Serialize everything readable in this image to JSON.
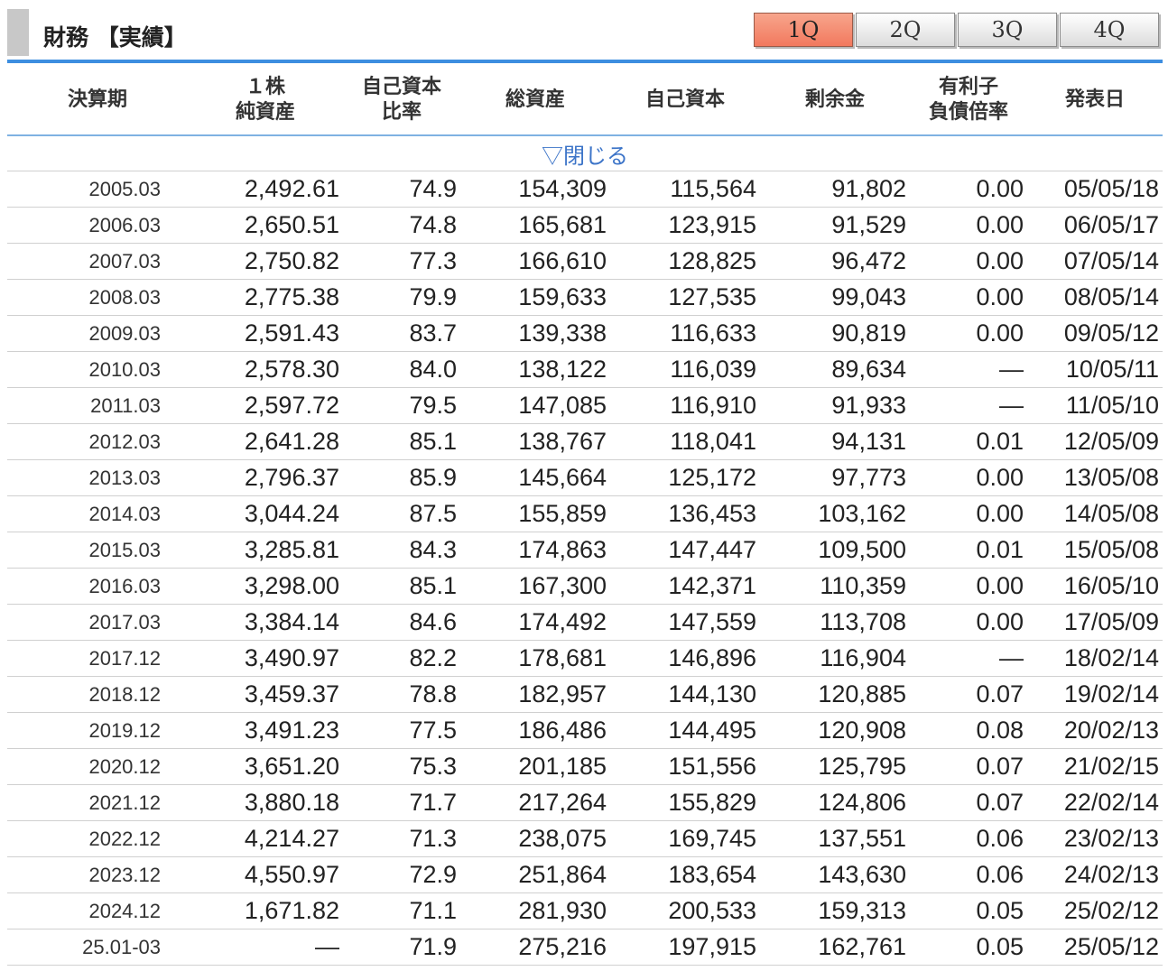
{
  "header": {
    "title": "財務 【実績】",
    "tabs": [
      "1Q",
      "2Q",
      "3Q",
      "4Q"
    ],
    "active_tab": "1Q"
  },
  "table": {
    "columns": [
      "決算期",
      "１株\n純資産",
      "自己資本\n比率",
      "総資産",
      "自己資本",
      "剰余金",
      "有利子\n負債倍率",
      "発表日"
    ],
    "toggle_label": "▽閉じる",
    "rows": [
      [
        "2005.03",
        "2,492.61",
        "74.9",
        "154,309",
        "115,564",
        "91,802",
        "0.00",
        "05/05/18"
      ],
      [
        "2006.03",
        "2,650.51",
        "74.8",
        "165,681",
        "123,915",
        "91,529",
        "0.00",
        "06/05/17"
      ],
      [
        "2007.03",
        "2,750.82",
        "77.3",
        "166,610",
        "128,825",
        "96,472",
        "0.00",
        "07/05/14"
      ],
      [
        "2008.03",
        "2,775.38",
        "79.9",
        "159,633",
        "127,535",
        "99,043",
        "0.00",
        "08/05/14"
      ],
      [
        "2009.03",
        "2,591.43",
        "83.7",
        "139,338",
        "116,633",
        "90,819",
        "0.00",
        "09/05/12"
      ],
      [
        "2010.03",
        "2,578.30",
        "84.0",
        "138,122",
        "116,039",
        "89,634",
        "—",
        "10/05/11"
      ],
      [
        "2011.03",
        "2,597.72",
        "79.5",
        "147,085",
        "116,910",
        "91,933",
        "—",
        "11/05/10"
      ],
      [
        "2012.03",
        "2,641.28",
        "85.1",
        "138,767",
        "118,041",
        "94,131",
        "0.01",
        "12/05/09"
      ],
      [
        "2013.03",
        "2,796.37",
        "85.9",
        "145,664",
        "125,172",
        "97,773",
        "0.00",
        "13/05/08"
      ],
      [
        "2014.03",
        "3,044.24",
        "87.5",
        "155,859",
        "136,453",
        "103,162",
        "0.00",
        "14/05/08"
      ],
      [
        "2015.03",
        "3,285.81",
        "84.3",
        "174,863",
        "147,447",
        "109,500",
        "0.01",
        "15/05/08"
      ],
      [
        "2016.03",
        "3,298.00",
        "85.1",
        "167,300",
        "142,371",
        "110,359",
        "0.00",
        "16/05/10"
      ],
      [
        "2017.03",
        "3,384.14",
        "84.6",
        "174,492",
        "147,559",
        "113,708",
        "0.00",
        "17/05/09"
      ],
      [
        "2017.12",
        "3,490.97",
        "82.2",
        "178,681",
        "146,896",
        "116,904",
        "—",
        "18/02/14"
      ],
      [
        "2018.12",
        "3,459.37",
        "78.8",
        "182,957",
        "144,130",
        "120,885",
        "0.07",
        "19/02/14"
      ],
      [
        "2019.12",
        "3,491.23",
        "77.5",
        "186,486",
        "144,495",
        "120,908",
        "0.08",
        "20/02/13"
      ],
      [
        "2020.12",
        "3,651.20",
        "75.3",
        "201,185",
        "151,556",
        "125,795",
        "0.07",
        "21/02/15"
      ],
      [
        "2021.12",
        "3,880.18",
        "71.7",
        "217,264",
        "155,829",
        "124,806",
        "0.07",
        "22/02/14"
      ],
      [
        "2022.12",
        "4,214.27",
        "71.3",
        "238,075",
        "169,745",
        "137,551",
        "0.06",
        "23/02/13"
      ],
      [
        "2023.12",
        "4,550.97",
        "72.9",
        "251,864",
        "183,654",
        "143,630",
        "0.06",
        "24/02/13"
      ],
      [
        "2024.12",
        "1,671.82",
        "71.1",
        "281,930",
        "200,533",
        "159,313",
        "0.05",
        "25/02/12"
      ],
      [
        "25.01-03",
        "—",
        "71.9",
        "275,216",
        "197,915",
        "162,761",
        "0.05",
        "25/05/12"
      ]
    ]
  },
  "colors": {
    "accent_blue": "#3d8ee0",
    "active_tab": "#f2795e",
    "link": "#3c74c8"
  }
}
